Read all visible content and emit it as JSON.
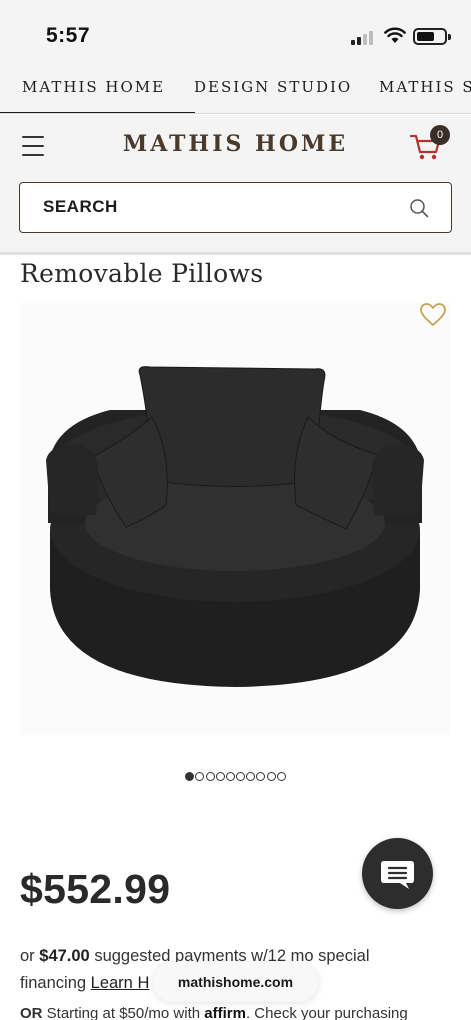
{
  "status_bar": {
    "time": "5:57"
  },
  "store_tabs": [
    {
      "label": "MATHIS HOME"
    },
    {
      "label": "DESIGN STUDIO"
    },
    {
      "label": "MATHIS S"
    }
  ],
  "header": {
    "logo": "MATHIS HOME",
    "cart_count": "0",
    "search_placeholder": "SEARCH"
  },
  "product": {
    "title": "Removable Pillows",
    "image_alt": "black round swivel chair with removable pillows",
    "gallery": {
      "total_images": 10,
      "active_index": 1
    },
    "price": "$552.99",
    "financing": {
      "prefix": "or",
      "amount": "$47.00",
      "text": "suggested payments w/12 mo special financing",
      "link": "Learn H"
    },
    "affirm": {
      "text": "Starting at $50/mo with",
      "brand": "affirm",
      "prefix": "OR",
      "suffix": "Check your purchasing"
    }
  },
  "browser": {
    "url": "mathishome.com"
  },
  "colors": {
    "brand_brown": "#4a3a2c",
    "cart_red": "#b5322c",
    "wishlist_gold": "#c6a355"
  }
}
